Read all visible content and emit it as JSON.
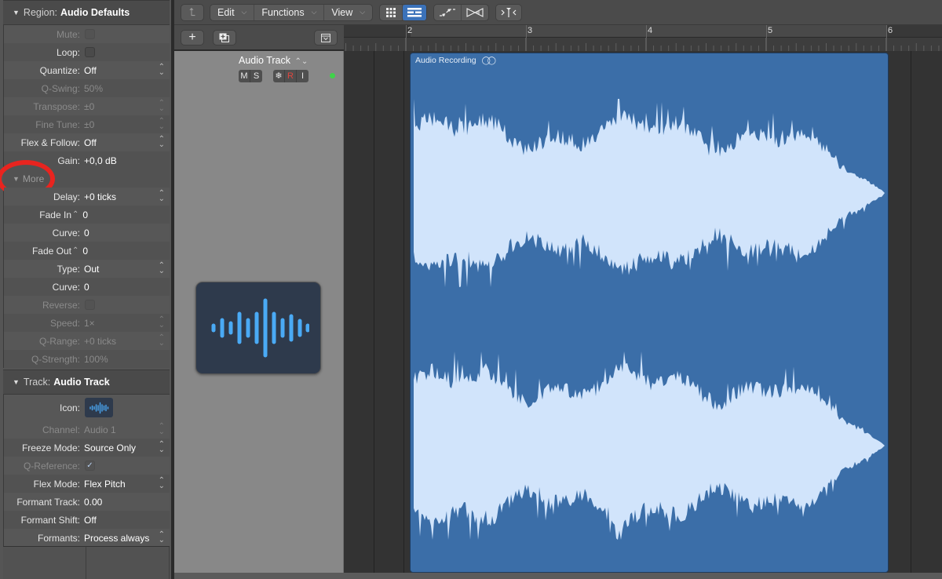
{
  "inspector": {
    "region": {
      "header_key": "Region:",
      "header_value": "Audio Defaults",
      "rows": [
        {
          "label": "Mute:",
          "type": "checkbox",
          "checked": false,
          "dim": true
        },
        {
          "label": "Loop:",
          "type": "checkbox",
          "checked": false,
          "dim": false
        },
        {
          "label": "Quantize:",
          "value": "Off",
          "stepper": true,
          "dim": false
        },
        {
          "label": "Q-Swing:",
          "value": "50%",
          "stepper": false,
          "dim": true
        },
        {
          "label": "Transpose:",
          "value": "±0",
          "stepper": true,
          "dim": true
        },
        {
          "label": "Fine Tune:",
          "value": "±0",
          "stepper": true,
          "dim": true
        },
        {
          "label": "Flex & Follow:",
          "value": "Off",
          "stepper": true,
          "dim": false
        },
        {
          "label": "Gain:",
          "value": "+0,0 dB",
          "stepper": false,
          "dim": false
        }
      ],
      "more_label": "More",
      "more_rows": [
        {
          "label": "Delay:",
          "value": "+0 ticks",
          "stepper": true,
          "dim": false
        },
        {
          "label": "Fade In",
          "value": "0",
          "label_stepper": true,
          "dim": false
        },
        {
          "label": "Curve:",
          "value": "0",
          "dim": false
        },
        {
          "label": "Fade Out",
          "value": "0",
          "label_stepper": true,
          "dim": false
        },
        {
          "label": "Type:",
          "value": "Out",
          "stepper": true,
          "dim": false
        },
        {
          "label": "Curve:",
          "value": "0",
          "dim": false
        },
        {
          "label": "Reverse:",
          "type": "checkbox",
          "checked": false,
          "dim": true
        },
        {
          "label": "Speed:",
          "value": "1×",
          "stepper": true,
          "dim": true
        },
        {
          "label": "Q-Range:",
          "value": "+0 ticks",
          "stepper": true,
          "dim": true
        },
        {
          "label": "Q-Strength:",
          "value": "100%",
          "dim": true
        }
      ]
    },
    "track": {
      "header_key": "Track:",
      "header_value": "Audio Track",
      "icon_label": "Icon:",
      "rows": [
        {
          "label": "Channel:",
          "value": "Audio 1",
          "stepper": true,
          "dim": true
        },
        {
          "label": "Freeze Mode:",
          "value": "Source Only",
          "stepper": true,
          "dim": false
        },
        {
          "label": "Q-Reference:",
          "type": "checkbox",
          "checked": true,
          "dim": true
        },
        {
          "label": "Flex Mode:",
          "value": "Flex Pitch",
          "stepper": true,
          "dim": false
        },
        {
          "label": "Formant Track:",
          "value": "0.00",
          "dim": false
        },
        {
          "label": "Formant Shift:",
          "value": "Off",
          "dim": false
        },
        {
          "label": "Formants:",
          "value": "Process always",
          "stepper": true,
          "dim": false
        }
      ]
    }
  },
  "toolbar": {
    "back_icon": "back-arrow-icon",
    "menus": [
      {
        "label": "Edit"
      },
      {
        "label": "Functions"
      },
      {
        "label": "View"
      }
    ],
    "view_buttons": [
      {
        "icon": "grid-view-icon",
        "active": false
      },
      {
        "icon": "list-view-icon",
        "active": true
      }
    ],
    "automation_buttons": [
      {
        "icon": "automation-curve-icon"
      },
      {
        "icon": "flex-icon"
      }
    ],
    "catch_button": {
      "icon": "catch-playhead-icon"
    }
  },
  "track_header": {
    "add_track_icon": "plus-icon",
    "duplicate_track_icon": "duplicate-track-icon",
    "collapse_icon": "collapse-icon",
    "track_name": "Audio Track",
    "buttons": {
      "mute": "M",
      "solo": "S",
      "freeze": "❄",
      "record": "R",
      "input": "I"
    },
    "record_color": "#e0463f",
    "led_color": "#3fd34a"
  },
  "ruler": {
    "bars": [
      "2",
      "3",
      "4",
      "5",
      "6"
    ]
  },
  "region": {
    "name": "Audio Recording",
    "loop_icon": "stereo-link-icon",
    "color": "#3b6ea8",
    "waveform_color": "#d1e4fb",
    "channels": 2
  }
}
